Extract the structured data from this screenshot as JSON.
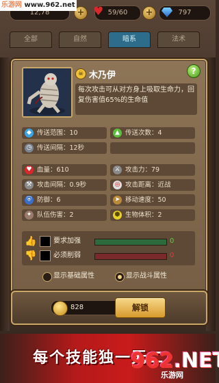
{
  "watermark_top": {
    "site": "乐游网",
    "url": "www.962.net"
  },
  "resources": {
    "gold_partial": "12,78",
    "hearts": "59/60",
    "gems": "797"
  },
  "tabs": [
    "全部",
    "自然",
    "暗系",
    "法术"
  ],
  "active_tab_index": 2,
  "unit": {
    "name": "木乃伊",
    "description": "每次攻击可从对方身上吸取生命力，回复伤害值65%的生命值"
  },
  "stats": {
    "transfer_range": "传送范围：10",
    "transfer_count": "传送次数：4",
    "transfer_interval": "传送间隔：12秒",
    "hp": "血量：610",
    "attack": "攻击力：79",
    "attack_interval": "攻击间隔：0.9秒",
    "attack_range": "攻击距离：近战",
    "defense": "防御：6",
    "move_speed": "移动速度：50",
    "team_damage": "队伍伤害：2",
    "body_size": "生物体积：2"
  },
  "adjust": {
    "buff_label": "要求加强",
    "buff_value": "0",
    "nerf_label": "必须削弱",
    "nerf_value": "0"
  },
  "radios": {
    "basic": "显示基础属性",
    "combat": "显示战斗属性",
    "selected": "combat"
  },
  "unlock": {
    "coins": "828",
    "button": "解锁"
  },
  "banner": {
    "text": "每个技能独一无二"
  },
  "watermark_bottom": {
    "big": "962",
    "suffix": ".NET",
    "sub": "乐游网"
  },
  "colors": {
    "buff_bar": "#2e6b3c",
    "nerf_bar": "#7a2a2a",
    "tab_active": "#2d6c8a",
    "banner_red": "#c81b1b"
  }
}
